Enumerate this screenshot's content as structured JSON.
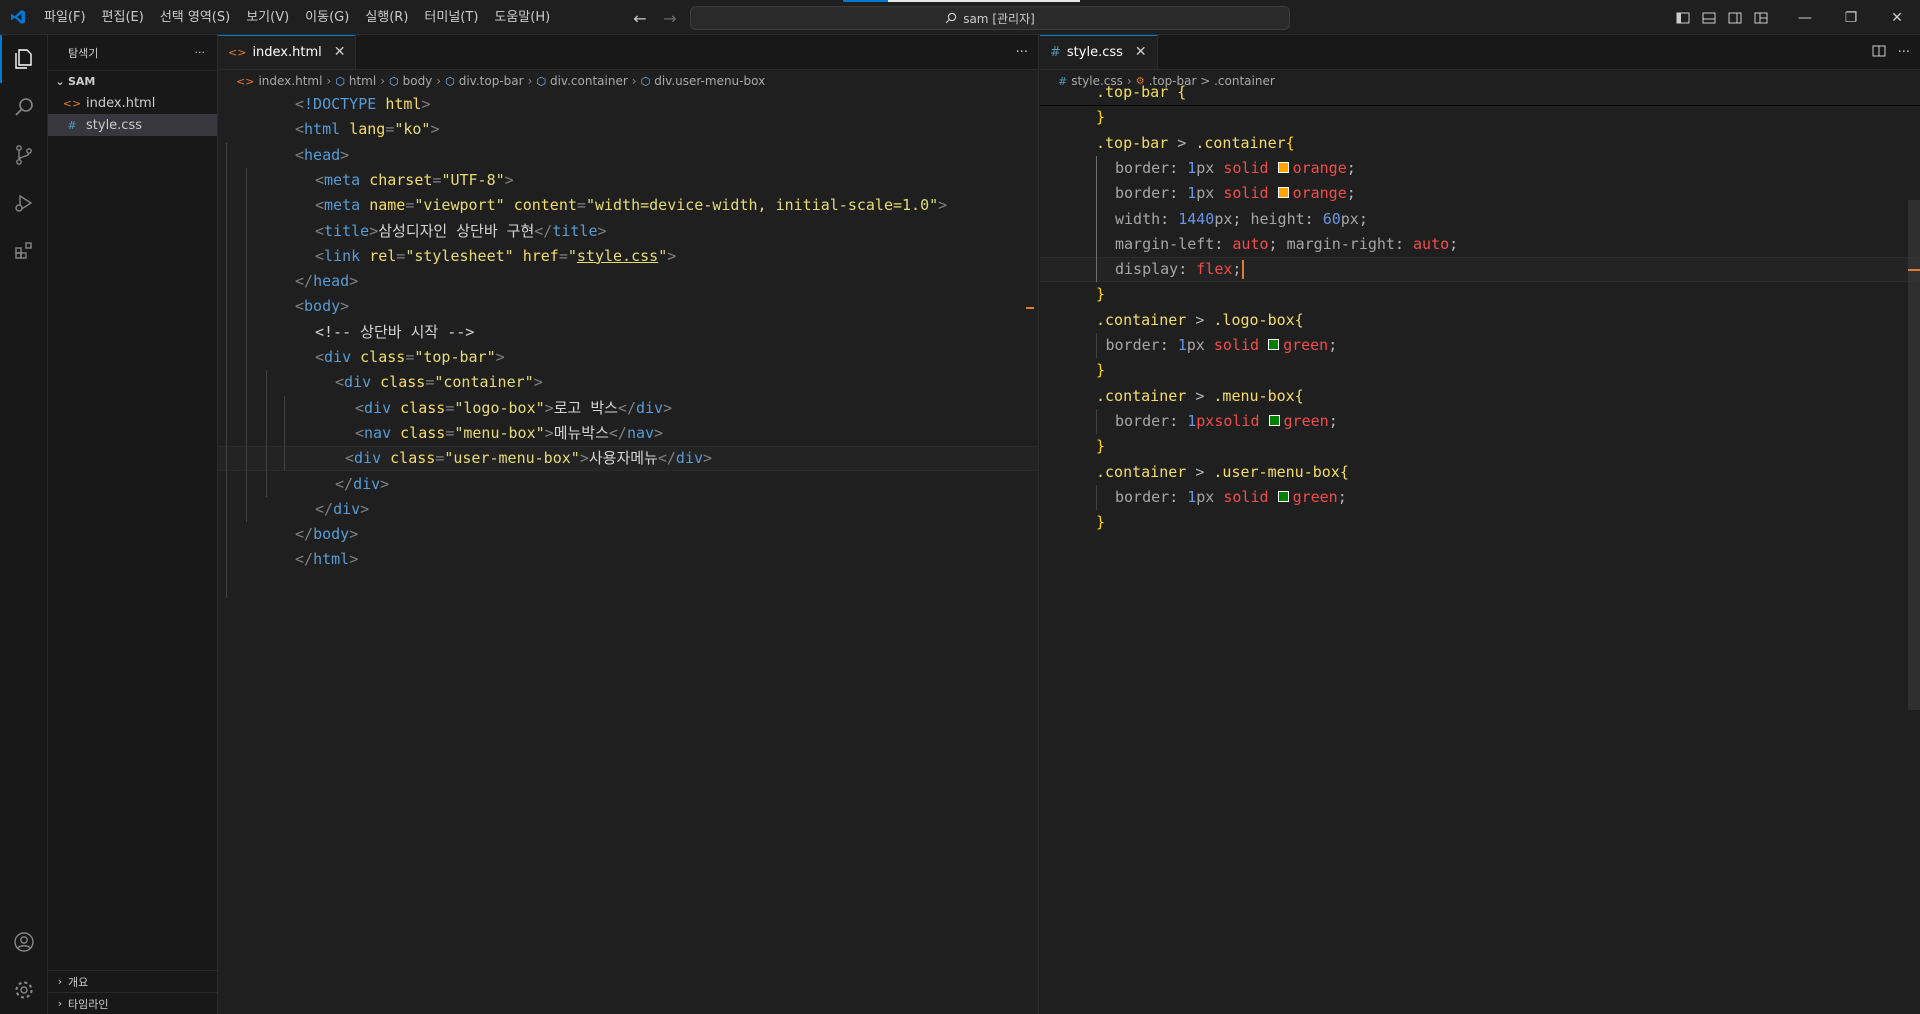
{
  "titlebar": {
    "menu": [
      "파일(F)",
      "편집(E)",
      "선택 영역(S)",
      "보기(V)",
      "이동(G)",
      "실행(R)",
      "터미널(T)",
      "도움말(H)"
    ],
    "search": "sam [관리자]"
  },
  "sidebar": {
    "title": "탐색기",
    "more": "···",
    "folder": "SAM",
    "files": [
      {
        "name": "index.html",
        "icon": "html-file-icon"
      },
      {
        "name": "style.css",
        "icon": "css-file-icon"
      }
    ],
    "outline": "개요",
    "timeline": "타임라인"
  },
  "left_editor": {
    "tab": "index.html",
    "breadcrumb": [
      "index.html",
      "html",
      "body",
      "div.top-bar",
      "div.container",
      "div.user-menu-box"
    ],
    "lines": [
      {
        "parts": [
          [
            "pn",
            "<"
          ],
          [
            "tg",
            "!DOCTYPE "
          ],
          [
            "at2",
            "html"
          ],
          [
            "pn",
            ">"
          ]
        ]
      },
      {
        "parts": [
          [
            "pn",
            "<"
          ],
          [
            "tg",
            "html "
          ],
          [
            "at2",
            "lang"
          ],
          [
            "pn",
            "="
          ],
          [
            "st2",
            "\"ko\""
          ],
          [
            "pn",
            ">"
          ]
        ]
      },
      {
        "parts": [
          [
            "pn",
            "<"
          ],
          [
            "tg",
            "head"
          ],
          [
            "pn",
            ">"
          ]
        ]
      },
      {
        "parts": [
          [
            "pn",
            "<"
          ],
          [
            "tg",
            "meta "
          ],
          [
            "at2",
            "charset"
          ],
          [
            "pn",
            "="
          ],
          [
            "st2",
            "\"UTF-8\""
          ],
          [
            "pn",
            ">"
          ]
        ]
      },
      {
        "parts": [
          [
            "pn",
            "<"
          ],
          [
            "tg",
            "meta "
          ],
          [
            "at2",
            "name"
          ],
          [
            "pn",
            "="
          ],
          [
            "st2",
            "\"viewport\" "
          ],
          [
            "at2",
            "content"
          ],
          [
            "pn",
            "="
          ],
          [
            "st2",
            "\"width=device-width, initial-scale=1.0\""
          ],
          [
            "pn",
            ">"
          ]
        ]
      },
      {
        "parts": [
          [
            "pn",
            "<"
          ],
          [
            "tg",
            "title"
          ],
          [
            "pn",
            ">"
          ],
          [
            "tx",
            "삼성디자인 상단바 구현"
          ],
          [
            "pn",
            "</"
          ],
          [
            "tg",
            "title"
          ],
          [
            "pn",
            ">"
          ]
        ]
      },
      {
        "parts": [
          [
            "pn",
            "<"
          ],
          [
            "tg",
            "link "
          ],
          [
            "at2",
            "rel"
          ],
          [
            "pn",
            "="
          ],
          [
            "st2",
            "\"stylesheet\" "
          ],
          [
            "at2",
            "href"
          ],
          [
            "pn",
            "="
          ],
          [
            "st2",
            "\""
          ],
          [
            "st2u",
            "style.css"
          ],
          [
            "st2",
            "\""
          ],
          [
            "pn",
            ">"
          ]
        ]
      },
      {
        "parts": [
          [
            "pn",
            "</"
          ],
          [
            "tg",
            "head"
          ],
          [
            "pn",
            ">"
          ]
        ]
      },
      {
        "parts": [
          [
            "pn",
            "<"
          ],
          [
            "tg",
            "body"
          ],
          [
            "pn",
            ">"
          ]
        ]
      },
      {
        "parts": [
          [
            "tx",
            "<!-- 상단바 시작 -->"
          ]
        ]
      },
      {
        "parts": [
          [
            "pn",
            "<"
          ],
          [
            "tg",
            "div "
          ],
          [
            "at2",
            "class"
          ],
          [
            "pn",
            "="
          ],
          [
            "st2",
            "\"top-bar\""
          ],
          [
            "pn",
            ">"
          ]
        ]
      },
      {
        "parts": [
          [
            "pn",
            "<"
          ],
          [
            "tg",
            "div "
          ],
          [
            "at2",
            "class"
          ],
          [
            "pn",
            "="
          ],
          [
            "st2",
            "\"container\""
          ],
          [
            "pn",
            ">"
          ]
        ]
      },
      {
        "parts": [
          [
            "pn",
            "<"
          ],
          [
            "tg",
            "div "
          ],
          [
            "at2",
            "class"
          ],
          [
            "pn",
            "="
          ],
          [
            "st2",
            "\"logo-box\""
          ],
          [
            "pn",
            ">"
          ],
          [
            "tx",
            "로고 박스"
          ],
          [
            "pn",
            "</"
          ],
          [
            "tg",
            "div"
          ],
          [
            "pn",
            ">"
          ]
        ]
      },
      {
        "parts": [
          [
            "pn",
            "<"
          ],
          [
            "tg",
            "nav "
          ],
          [
            "at2",
            "class"
          ],
          [
            "pn",
            "="
          ],
          [
            "st2",
            "\"menu-box\""
          ],
          [
            "pn",
            ">"
          ],
          [
            "tx",
            "메뉴박스"
          ],
          [
            "pn",
            "</"
          ],
          [
            "tg",
            "nav"
          ],
          [
            "pn",
            ">"
          ]
        ]
      },
      {
        "parts": [
          [
            "pn",
            "<"
          ],
          [
            "tg",
            "div "
          ],
          [
            "at2",
            "class"
          ],
          [
            "pn",
            "="
          ],
          [
            "st2",
            "\"user-menu-box\""
          ],
          [
            "pn",
            ">"
          ],
          [
            "tx",
            "사용자메뉴"
          ],
          [
            "pn",
            "</"
          ],
          [
            "tg",
            "div"
          ],
          [
            "pn",
            ">"
          ]
        ]
      },
      {
        "parts": [
          [
            "pn",
            "</"
          ],
          [
            "tg",
            "div"
          ],
          [
            "pn",
            ">"
          ]
        ]
      },
      {
        "parts": [
          [
            "pn",
            "</"
          ],
          [
            "tg",
            "div"
          ],
          [
            "pn",
            ">"
          ]
        ]
      },
      {
        "parts": [
          [
            "pn",
            "</"
          ],
          [
            "tg",
            "body"
          ],
          [
            "pn",
            ">"
          ]
        ]
      },
      {
        "parts": [
          [
            "pn",
            "</"
          ],
          [
            "tg",
            "html"
          ],
          [
            "pn",
            ">"
          ]
        ]
      }
    ]
  },
  "right_editor": {
    "tab": "style.css",
    "breadcrumb": [
      "style.css",
      ".top-bar > .container"
    ],
    "lines": [
      {
        "parts": [
          [
            "sel",
            ".top-bar {"
          ]
        ]
      },
      {
        "parts": [
          [
            "br",
            "}"
          ]
        ]
      },
      {
        "parts": [
          [
            "sel",
            ".top-bar "
          ],
          [
            "pn",
            "> "
          ],
          [
            "sel",
            ".container"
          ],
          [
            "br",
            "{"
          ]
        ]
      },
      {
        "parts": [
          [
            "prop",
            "border"
          ],
          [
            "pn",
            ": "
          ],
          [
            "num",
            "1"
          ],
          [
            "prop",
            "px "
          ],
          [
            "kw",
            "solid "
          ],
          [
            "sw",
            "#ffa500"
          ],
          [
            "kw",
            "orange"
          ],
          [
            "pn",
            ";"
          ]
        ]
      },
      {
        "parts": [
          [
            "prop",
            "border"
          ],
          [
            "pn",
            ": "
          ],
          [
            "num",
            "1"
          ],
          [
            "prop",
            "px "
          ],
          [
            "kw",
            "solid "
          ],
          [
            "sw",
            "#ffa500"
          ],
          [
            "kw",
            "orange"
          ],
          [
            "pn",
            ";"
          ]
        ]
      },
      {
        "parts": [
          [
            "prop",
            "width"
          ],
          [
            "pn",
            ": "
          ],
          [
            "num",
            "1440"
          ],
          [
            "prop",
            "px"
          ],
          [
            "pn",
            "; "
          ],
          [
            "prop",
            "height"
          ],
          [
            "pn",
            ": "
          ],
          [
            "num",
            "60"
          ],
          [
            "prop",
            "px"
          ],
          [
            "pn",
            ";"
          ]
        ]
      },
      {
        "parts": [
          [
            "prop",
            "margin-left"
          ],
          [
            "pn",
            ": "
          ],
          [
            "kw",
            "auto"
          ],
          [
            "pn",
            "; "
          ],
          [
            "prop",
            "margin-right"
          ],
          [
            "pn",
            ": "
          ],
          [
            "kw",
            "auto"
          ],
          [
            "pn",
            ";"
          ]
        ]
      },
      {
        "parts": [
          [
            "prop",
            "display"
          ],
          [
            "pn",
            ": "
          ],
          [
            "kw",
            "flex"
          ],
          [
            "pn",
            ";"
          ]
        ]
      },
      {
        "parts": [
          [
            "br",
            "}"
          ]
        ]
      },
      {
        "parts": [
          [
            "sel",
            ".container "
          ],
          [
            "pn",
            "> "
          ],
          [
            "sel",
            ".logo-box{"
          ]
        ]
      },
      {
        "parts": [
          [
            "prop",
            "border"
          ],
          [
            "pn",
            ": "
          ],
          [
            "num",
            "1"
          ],
          [
            "prop",
            "px "
          ],
          [
            "kw",
            "solid "
          ],
          [
            "sw",
            "#008000"
          ],
          [
            "kw",
            "green"
          ],
          [
            "pn",
            ";"
          ]
        ]
      },
      {
        "parts": [
          [
            "br",
            "}"
          ]
        ]
      },
      {
        "parts": [
          [
            "sel",
            ".container "
          ],
          [
            "pn",
            "> "
          ],
          [
            "sel",
            ".menu-box{"
          ]
        ]
      },
      {
        "parts": [
          [
            "prop",
            "border"
          ],
          [
            "pn",
            ": "
          ],
          [
            "num",
            "1"
          ],
          [
            "kw",
            "pxsolid "
          ],
          [
            "sw",
            "#008000"
          ],
          [
            "kw",
            "green"
          ],
          [
            "pn",
            ";"
          ]
        ]
      },
      {
        "parts": [
          [
            "br",
            "}"
          ]
        ]
      },
      {
        "parts": [
          [
            "sel",
            ".container "
          ],
          [
            "pn",
            "> "
          ],
          [
            "sel",
            ".user-menu-box{"
          ]
        ]
      },
      {
        "parts": [
          [
            "prop",
            "border"
          ],
          [
            "pn",
            ": "
          ],
          [
            "num",
            "1"
          ],
          [
            "prop",
            "px "
          ],
          [
            "kw",
            "solid "
          ],
          [
            "sw",
            "#008000"
          ],
          [
            "kw",
            "green"
          ],
          [
            "pn",
            ";"
          ]
        ]
      },
      {
        "parts": [
          [
            "br",
            "}"
          ]
        ]
      }
    ]
  },
  "colors": {
    "accent": "#0078d4",
    "cursor": "#e37933"
  }
}
